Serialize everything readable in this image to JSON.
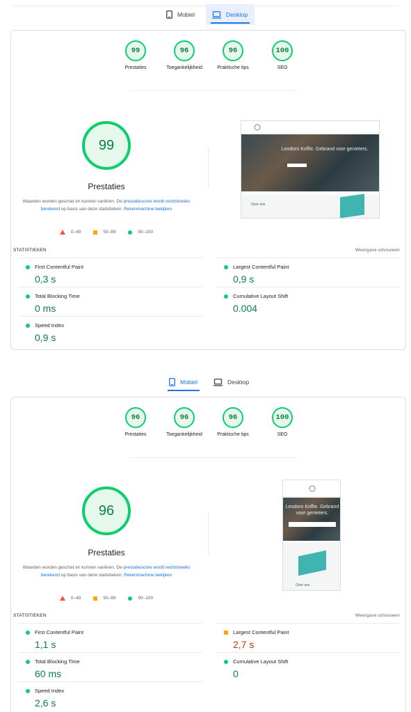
{
  "colors": {
    "accent": "#1a73e8",
    "pass": "#0cce6b",
    "average": "#ffa400",
    "fail": "#ff4e42"
  },
  "desktop_report": {
    "tabs": {
      "mobile_label": "Mobiel",
      "desktop_label": "Desktop",
      "active": "desktop"
    },
    "gauges": [
      {
        "score": "99",
        "label": "Prestaties"
      },
      {
        "score": "96",
        "label": "Toegankelijkheid"
      },
      {
        "score": "96",
        "label": "Praktische tips"
      },
      {
        "score": "100",
        "label": "SEO"
      }
    ],
    "performance": {
      "score": "99",
      "title": "Prestaties",
      "desc_1": "Waarden worden geschat en kunnen variëren. De ",
      "desc_link_1": "prestatiescore wordt rechtstreeks berekend",
      "desc_2": " op basis van deze statistieken. ",
      "desc_link_2": "Rekenmachine bekijken"
    },
    "legend": {
      "fail": "0–49",
      "average": "50–89",
      "pass": "90–100"
    },
    "screenshot": {
      "hero_text": "Leodoro Koffie. Gebrand voor genieters.",
      "section_text": "Over ons"
    },
    "stats": {
      "heading": "STATISTIEKEN",
      "expand": "Weergave uitvouwen",
      "metrics": [
        {
          "name": "First Contentful Paint",
          "value": "0,3 s",
          "status": "pass"
        },
        {
          "name": "Largest Contentful Paint",
          "value": "0,9 s",
          "status": "pass"
        },
        {
          "name": "Total Blocking Time",
          "value": "0 ms",
          "status": "pass"
        },
        {
          "name": "Cumulative Layout Shift",
          "value": "0.004",
          "status": "pass"
        },
        {
          "name": "Speed Index",
          "value": "0,9 s",
          "status": "pass"
        }
      ]
    }
  },
  "mobile_report": {
    "tabs": {
      "mobile_label": "Mobiel",
      "desktop_label": "Desktop",
      "active": "mobile"
    },
    "gauges": [
      {
        "score": "96",
        "label": "Prestaties"
      },
      {
        "score": "96",
        "label": "Toegankelijkheid"
      },
      {
        "score": "96",
        "label": "Praktische tips"
      },
      {
        "score": "100",
        "label": "SEO"
      }
    ],
    "performance": {
      "score": "96",
      "title": "Prestaties",
      "desc_1": "Waarden worden geschat en kunnen variëren. De ",
      "desc_link_1": "prestatiescore wordt rechtstreeks berekend",
      "desc_2": " op basis van deze statistieken. ",
      "desc_link_2": "Rekenmachine bekijken"
    },
    "legend": {
      "fail": "0–49",
      "average": "50–89",
      "pass": "90–100"
    },
    "screenshot": {
      "hero_text": "Leodoro Koffie. Gebrand voor genieters.",
      "section_text": "Over ons"
    },
    "stats": {
      "heading": "STATISTIEKEN",
      "expand": "Weergave uitvouwen",
      "metrics": [
        {
          "name": "First Contentful Paint",
          "value": "1,1 s",
          "status": "pass"
        },
        {
          "name": "Largest Contentful Paint",
          "value": "2,7 s",
          "status": "average"
        },
        {
          "name": "Total Blocking Time",
          "value": "60 ms",
          "status": "pass"
        },
        {
          "name": "Cumulative Layout Shift",
          "value": "0",
          "status": "pass"
        },
        {
          "name": "Speed Index",
          "value": "2,6 s",
          "status": "pass"
        }
      ]
    }
  }
}
